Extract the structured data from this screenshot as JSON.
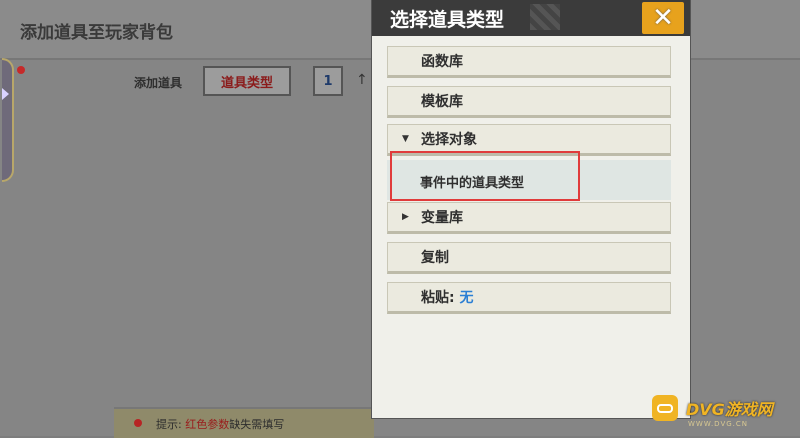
{
  "background": {
    "title": "添加道具至玩家背包",
    "add_label": "添加道具",
    "type_button": "道具类型",
    "quantity": "1",
    "up_arrow": "↑",
    "hint": {
      "prefix": "提示: ",
      "red": "红色参数",
      "suffix": "缺失需填写"
    }
  },
  "dialog": {
    "title": "选择道具类型",
    "close": "✕",
    "options": [
      {
        "label": "函数库"
      },
      {
        "label": "模板库"
      },
      {
        "label": "选择对象",
        "expander": "▼"
      },
      {
        "label": "变量库",
        "expander": "▶"
      },
      {
        "label": "复制"
      },
      {
        "label": "粘贴",
        "value": "无"
      }
    ],
    "sub_option": "事件中的道具类型"
  },
  "watermark": {
    "brand": "DVG游戏网",
    "url": "WWW.DVG.CN"
  },
  "colors": {
    "accent": "#e7a21d",
    "highlight": "#e03b3b",
    "link": "#2b7fd4"
  }
}
